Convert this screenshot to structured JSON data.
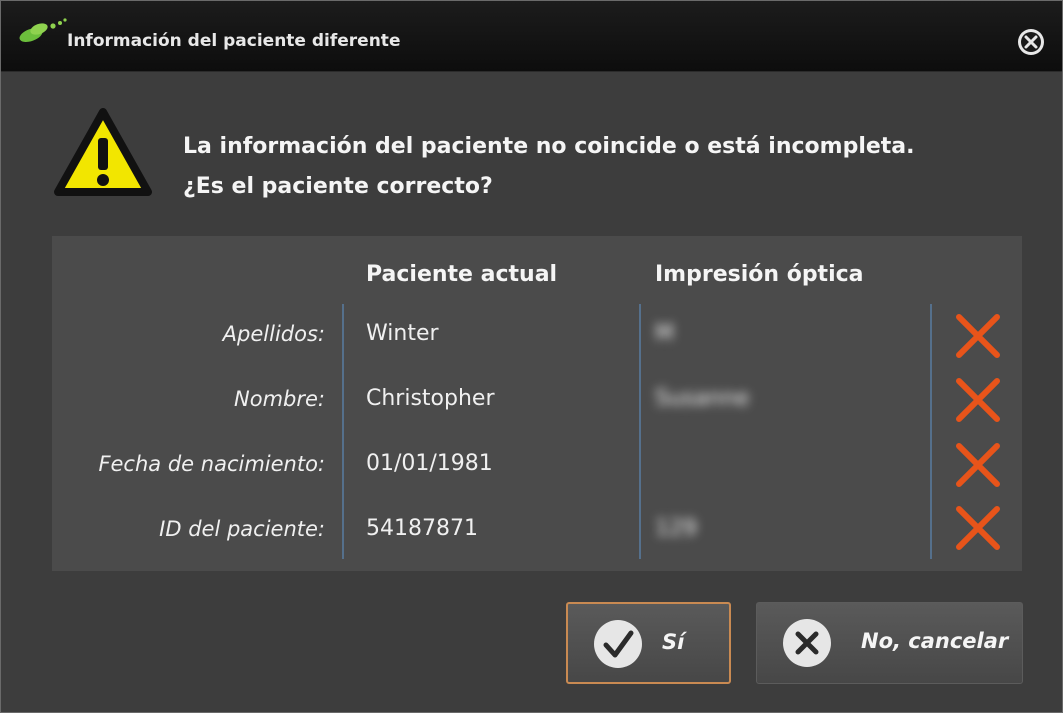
{
  "window": {
    "title": "Información del paciente diferente"
  },
  "message": {
    "line1": "La información del paciente no coincide o está incompleta.",
    "line2": "¿Es el paciente correcto?"
  },
  "table": {
    "headers": {
      "current": "Paciente actual",
      "optical": "Impresión óptica"
    },
    "rows": [
      {
        "label": "Apellidos:",
        "current": "Winter",
        "optical": "M",
        "match": false
      },
      {
        "label": "Nombre:",
        "current": "Christopher",
        "optical": "Susanne",
        "match": false
      },
      {
        "label": "Fecha de nacimiento:",
        "current": "01/01/1981",
        "optical": "",
        "match": false
      },
      {
        "label": "ID del paciente:",
        "current": "54187871",
        "optical": "129",
        "match": false
      }
    ]
  },
  "buttons": {
    "yes_label": "Sí",
    "no_label": "No, cancelar"
  },
  "colors": {
    "mismatch": "#e8541a",
    "warning": "#f2e600",
    "accent_border": "#c98a52",
    "divider": "#55708c"
  },
  "icons": {
    "app": "app-logo-icon",
    "close": "close-circle-icon",
    "warning": "warning-triangle-icon",
    "mismatch": "x-mark-icon",
    "yes": "check-circle-icon",
    "no": "x-circle-icon"
  }
}
